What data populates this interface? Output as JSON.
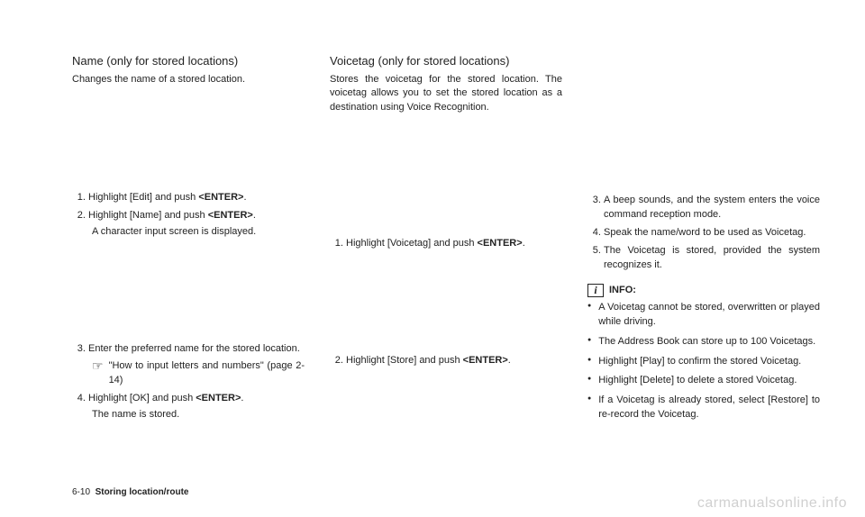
{
  "col1": {
    "title": "Name (only for stored locations)",
    "desc": "Changes the name of a stored location.",
    "steps1": [
      {
        "pre": "Highlight [Edit] and push ",
        "bold": "<ENTER>",
        "post": "."
      },
      {
        "pre": "Highlight [Name] and push ",
        "bold": "<ENTER>",
        "post": ".",
        "sub": "A character input screen is displayed."
      }
    ],
    "steps2": [
      {
        "pre": "Enter the preferred name for the stored location.",
        "bold": "",
        "post": "",
        "ref": "\"How to input letters and numbers\" (page 2-14)"
      },
      {
        "pre": "Highlight [OK] and push ",
        "bold": "<ENTER>",
        "post": ".",
        "sub": "The name is stored."
      }
    ]
  },
  "col2": {
    "title": "Voicetag (only for stored locations)",
    "desc": "Stores the voicetag for the stored location. The voicetag allows you to set the stored location as a destination using Voice Recognition.",
    "steps1": [
      {
        "pre": "Highlight [Voicetag] and push ",
        "bold": "<ENTER>",
        "post": "."
      }
    ],
    "steps2": [
      {
        "pre": "Highlight [Store] and push ",
        "bold": "<ENTER>",
        "post": "."
      }
    ]
  },
  "col3": {
    "steps": [
      {
        "text": "A beep sounds, and the system enters the voice command reception mode."
      },
      {
        "text": "Speak the name/word to be used as Voicetag."
      },
      {
        "text": "The Voicetag is stored, provided the system recognizes it."
      }
    ],
    "info_label": "INFO:",
    "bullets": [
      "A Voicetag cannot be stored, overwritten or played while driving.",
      "The Address Book can store up to 100 Voicetags.",
      "Highlight [Play] to confirm the stored Voicetag.",
      "Highlight [Delete] to delete a stored Voicetag.",
      "If a Voicetag is already stored, select [Restore] to re-record the Voicetag."
    ]
  },
  "footer": {
    "page": "6-10",
    "section": "Storing location/route"
  },
  "watermark": "carmanualsonline.info"
}
